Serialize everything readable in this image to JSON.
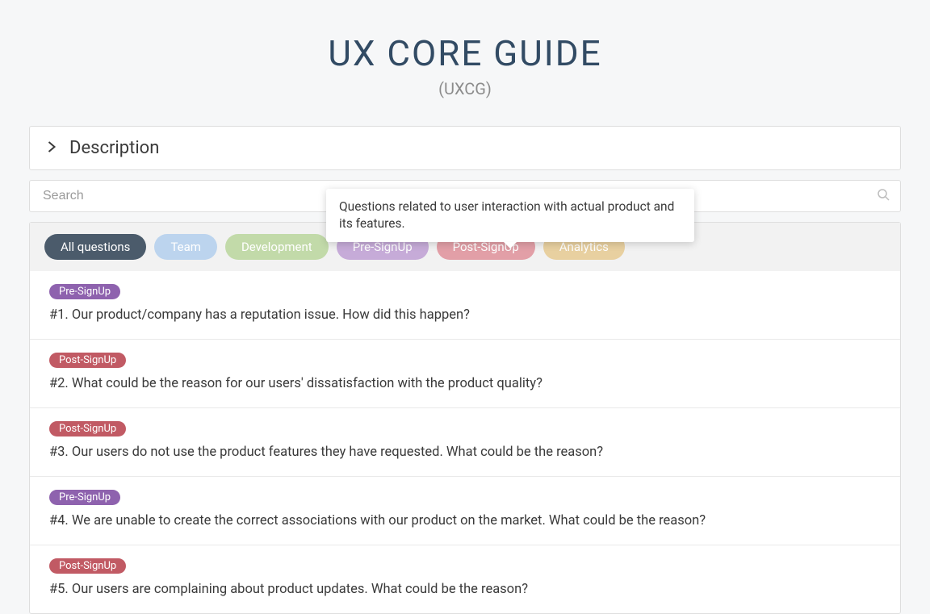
{
  "header": {
    "title": "UX CORE GUIDE",
    "subtitle": "(UXCG)"
  },
  "description": {
    "label": "Description"
  },
  "search": {
    "placeholder": "Search"
  },
  "filters": {
    "all": "All questions",
    "team": "Team",
    "development": "Development",
    "pre": "Pre-SignUp",
    "post": "Post-SignUp",
    "analytics": "Analytics"
  },
  "tooltip": {
    "text": "Questions related to user interaction with actual product and its features."
  },
  "badges": {
    "pre": "Pre-SignUp",
    "post": "Post-SignUp"
  },
  "questions": [
    {
      "badge": "pre",
      "text": "#1.  Our product/company has a reputation issue. How did this happen?"
    },
    {
      "badge": "post",
      "text": "#2.  What could be the reason for our users' dissatisfaction with the product quality?"
    },
    {
      "badge": "post",
      "text": "#3.  Our users do not use the product features they have requested. What could be the reason?"
    },
    {
      "badge": "pre",
      "text": "#4.  We are unable to create the correct associations with our product on the market. What could be the reason?"
    },
    {
      "badge": "post",
      "text": "#5.  Our users are complaining about product updates. What could be the reason?"
    }
  ]
}
